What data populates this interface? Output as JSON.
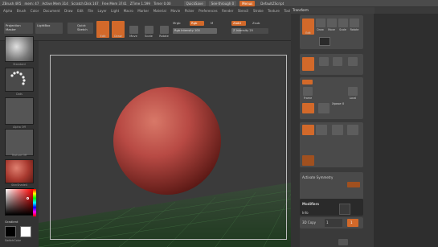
{
  "title_bar": {
    "segments": [
      "ZBrush 4R5",
      "mem: 47",
      "Active Mem 314",
      "Scratch Disk 167",
      "Free Mem 3741",
      "ZTime 1.599",
      "Timer 0.00"
    ],
    "quicksave": "QuickSave",
    "seethrough": "See-through 0",
    "menus": "Menus",
    "default_script": "DefaultZScript"
  },
  "menu_bar": {
    "items": [
      "Alpha",
      "Brush",
      "Color",
      "Document",
      "Draw",
      "Edit",
      "File",
      "Layer",
      "Light",
      "Macro",
      "Marker",
      "Material",
      "Movie",
      "Picker",
      "Preferences",
      "Render",
      "Stencil",
      "Stroke",
      "Texture",
      "Tool",
      "Transform",
      "Zplugin",
      "Zscript"
    ]
  },
  "toolbar": {
    "projection_master": "Projection Master",
    "lightbox": "LightBox",
    "quick_sketch": "Quick Sketch",
    "edit": "Edit",
    "draw": "Draw",
    "move": "Move",
    "scale": "Scale",
    "rotate": "Rotate",
    "mrgb": "Mrgb",
    "rgb": "Rgb",
    "m": "M",
    "rgb_intensity": "Rgb Intensity 100",
    "zadd": "Zadd",
    "zsub": "Zsub",
    "z_intensity": "Z Intensity 25",
    "focal_shift": "Focal Shift 0",
    "draw_size": "Draw Size 64"
  },
  "left_shelf": {
    "brush_label": "Standard",
    "stroke_label": "Dots",
    "alpha_label": "Alpha Off",
    "texture_label": "Texture Off",
    "material_label": "SkinShade4",
    "gradient": "Gradient",
    "switch_color": "SwitchColor"
  },
  "right_tray": {
    "transform_header": "Transform",
    "edit": "Edit",
    "draw": "Draw",
    "move": "Move",
    "scale": "Scale",
    "rotate": "Rotate",
    "frame": "Frame",
    "local": "Local",
    "xyz": "Xyz",
    "xpose": "Xpose 0",
    "activate_symmetry": "Activate Symmetry",
    "modifiers": "Modifiers",
    "info": "Info",
    "lock_camera": "Lock Camera",
    "copy": "3D Copy",
    "copy_value": "1",
    "copy_max": "1",
    "transp": "Transp",
    "ghost": "Ghost",
    "solo": "Solo"
  },
  "colors": {
    "accent": "#d2692a",
    "sphere": "#b84a44",
    "floor": "#2e4a2e",
    "panel": "#4a4a4a"
  }
}
